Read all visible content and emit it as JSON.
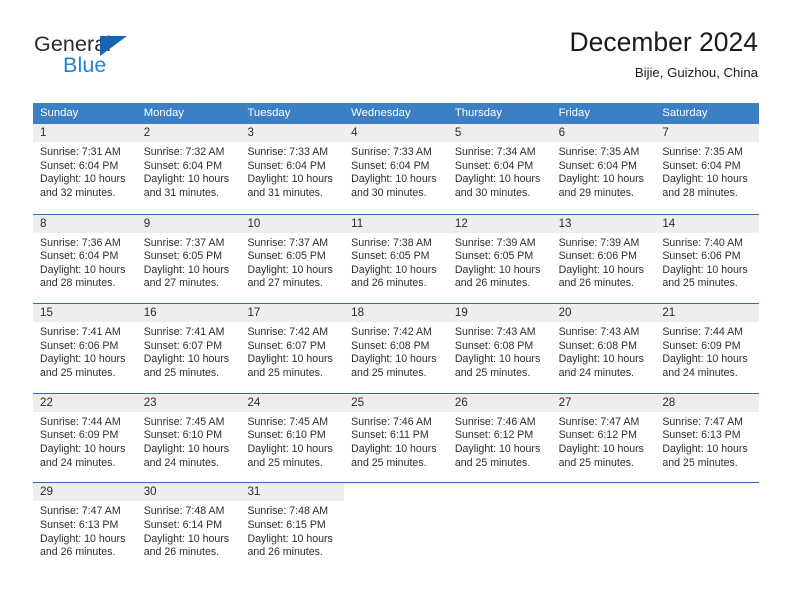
{
  "brand": {
    "word_one": "General",
    "word_two": "Blue",
    "triangle_icon": "triangle-icon"
  },
  "header": {
    "title": "December 2024",
    "location": "Bijie, Guizhou, China"
  },
  "colors": {
    "header_band": "#3b7fc4",
    "row_divider": "#2f6fb0",
    "daynum_band": "#eeeeee",
    "brand_dark": "#2b2b2b",
    "brand_blue": "#1f84d6",
    "logo_triangle": "#1665b0",
    "text": "#2e2e2e"
  },
  "weekday_headers": [
    "Sunday",
    "Monday",
    "Tuesday",
    "Wednesday",
    "Thursday",
    "Friday",
    "Saturday"
  ],
  "weeks": [
    [
      {
        "day": "1",
        "sunrise": "Sunrise: 7:31 AM",
        "sunset": "Sunset: 6:04 PM",
        "daylight_1": "Daylight: 10 hours",
        "daylight_2": "and 32 minutes."
      },
      {
        "day": "2",
        "sunrise": "Sunrise: 7:32 AM",
        "sunset": "Sunset: 6:04 PM",
        "daylight_1": "Daylight: 10 hours",
        "daylight_2": "and 31 minutes."
      },
      {
        "day": "3",
        "sunrise": "Sunrise: 7:33 AM",
        "sunset": "Sunset: 6:04 PM",
        "daylight_1": "Daylight: 10 hours",
        "daylight_2": "and 31 minutes."
      },
      {
        "day": "4",
        "sunrise": "Sunrise: 7:33 AM",
        "sunset": "Sunset: 6:04 PM",
        "daylight_1": "Daylight: 10 hours",
        "daylight_2": "and 30 minutes."
      },
      {
        "day": "5",
        "sunrise": "Sunrise: 7:34 AM",
        "sunset": "Sunset: 6:04 PM",
        "daylight_1": "Daylight: 10 hours",
        "daylight_2": "and 30 minutes."
      },
      {
        "day": "6",
        "sunrise": "Sunrise: 7:35 AM",
        "sunset": "Sunset: 6:04 PM",
        "daylight_1": "Daylight: 10 hours",
        "daylight_2": "and 29 minutes."
      },
      {
        "day": "7",
        "sunrise": "Sunrise: 7:35 AM",
        "sunset": "Sunset: 6:04 PM",
        "daylight_1": "Daylight: 10 hours",
        "daylight_2": "and 28 minutes."
      }
    ],
    [
      {
        "day": "8",
        "sunrise": "Sunrise: 7:36 AM",
        "sunset": "Sunset: 6:04 PM",
        "daylight_1": "Daylight: 10 hours",
        "daylight_2": "and 28 minutes."
      },
      {
        "day": "9",
        "sunrise": "Sunrise: 7:37 AM",
        "sunset": "Sunset: 6:05 PM",
        "daylight_1": "Daylight: 10 hours",
        "daylight_2": "and 27 minutes."
      },
      {
        "day": "10",
        "sunrise": "Sunrise: 7:37 AM",
        "sunset": "Sunset: 6:05 PM",
        "daylight_1": "Daylight: 10 hours",
        "daylight_2": "and 27 minutes."
      },
      {
        "day": "11",
        "sunrise": "Sunrise: 7:38 AM",
        "sunset": "Sunset: 6:05 PM",
        "daylight_1": "Daylight: 10 hours",
        "daylight_2": "and 26 minutes."
      },
      {
        "day": "12",
        "sunrise": "Sunrise: 7:39 AM",
        "sunset": "Sunset: 6:05 PM",
        "daylight_1": "Daylight: 10 hours",
        "daylight_2": "and 26 minutes."
      },
      {
        "day": "13",
        "sunrise": "Sunrise: 7:39 AM",
        "sunset": "Sunset: 6:06 PM",
        "daylight_1": "Daylight: 10 hours",
        "daylight_2": "and 26 minutes."
      },
      {
        "day": "14",
        "sunrise": "Sunrise: 7:40 AM",
        "sunset": "Sunset: 6:06 PM",
        "daylight_1": "Daylight: 10 hours",
        "daylight_2": "and 25 minutes."
      }
    ],
    [
      {
        "day": "15",
        "sunrise": "Sunrise: 7:41 AM",
        "sunset": "Sunset: 6:06 PM",
        "daylight_1": "Daylight: 10 hours",
        "daylight_2": "and 25 minutes."
      },
      {
        "day": "16",
        "sunrise": "Sunrise: 7:41 AM",
        "sunset": "Sunset: 6:07 PM",
        "daylight_1": "Daylight: 10 hours",
        "daylight_2": "and 25 minutes."
      },
      {
        "day": "17",
        "sunrise": "Sunrise: 7:42 AM",
        "sunset": "Sunset: 6:07 PM",
        "daylight_1": "Daylight: 10 hours",
        "daylight_2": "and 25 minutes."
      },
      {
        "day": "18",
        "sunrise": "Sunrise: 7:42 AM",
        "sunset": "Sunset: 6:08 PM",
        "daylight_1": "Daylight: 10 hours",
        "daylight_2": "and 25 minutes."
      },
      {
        "day": "19",
        "sunrise": "Sunrise: 7:43 AM",
        "sunset": "Sunset: 6:08 PM",
        "daylight_1": "Daylight: 10 hours",
        "daylight_2": "and 25 minutes."
      },
      {
        "day": "20",
        "sunrise": "Sunrise: 7:43 AM",
        "sunset": "Sunset: 6:08 PM",
        "daylight_1": "Daylight: 10 hours",
        "daylight_2": "and 24 minutes."
      },
      {
        "day": "21",
        "sunrise": "Sunrise: 7:44 AM",
        "sunset": "Sunset: 6:09 PM",
        "daylight_1": "Daylight: 10 hours",
        "daylight_2": "and 24 minutes."
      }
    ],
    [
      {
        "day": "22",
        "sunrise": "Sunrise: 7:44 AM",
        "sunset": "Sunset: 6:09 PM",
        "daylight_1": "Daylight: 10 hours",
        "daylight_2": "and 24 minutes."
      },
      {
        "day": "23",
        "sunrise": "Sunrise: 7:45 AM",
        "sunset": "Sunset: 6:10 PM",
        "daylight_1": "Daylight: 10 hours",
        "daylight_2": "and 24 minutes."
      },
      {
        "day": "24",
        "sunrise": "Sunrise: 7:45 AM",
        "sunset": "Sunset: 6:10 PM",
        "daylight_1": "Daylight: 10 hours",
        "daylight_2": "and 25 minutes."
      },
      {
        "day": "25",
        "sunrise": "Sunrise: 7:46 AM",
        "sunset": "Sunset: 6:11 PM",
        "daylight_1": "Daylight: 10 hours",
        "daylight_2": "and 25 minutes."
      },
      {
        "day": "26",
        "sunrise": "Sunrise: 7:46 AM",
        "sunset": "Sunset: 6:12 PM",
        "daylight_1": "Daylight: 10 hours",
        "daylight_2": "and 25 minutes."
      },
      {
        "day": "27",
        "sunrise": "Sunrise: 7:47 AM",
        "sunset": "Sunset: 6:12 PM",
        "daylight_1": "Daylight: 10 hours",
        "daylight_2": "and 25 minutes."
      },
      {
        "day": "28",
        "sunrise": "Sunrise: 7:47 AM",
        "sunset": "Sunset: 6:13 PM",
        "daylight_1": "Daylight: 10 hours",
        "daylight_2": "and 25 minutes."
      }
    ],
    [
      {
        "day": "29",
        "sunrise": "Sunrise: 7:47 AM",
        "sunset": "Sunset: 6:13 PM",
        "daylight_1": "Daylight: 10 hours",
        "daylight_2": "and 26 minutes."
      },
      {
        "day": "30",
        "sunrise": "Sunrise: 7:48 AM",
        "sunset": "Sunset: 6:14 PM",
        "daylight_1": "Daylight: 10 hours",
        "daylight_2": "and 26 minutes."
      },
      {
        "day": "31",
        "sunrise": "Sunrise: 7:48 AM",
        "sunset": "Sunset: 6:15 PM",
        "daylight_1": "Daylight: 10 hours",
        "daylight_2": "and 26 minutes."
      },
      {
        "day": "",
        "sunrise": "",
        "sunset": "",
        "daylight_1": "",
        "daylight_2": ""
      },
      {
        "day": "",
        "sunrise": "",
        "sunset": "",
        "daylight_1": "",
        "daylight_2": ""
      },
      {
        "day": "",
        "sunrise": "",
        "sunset": "",
        "daylight_1": "",
        "daylight_2": ""
      },
      {
        "day": "",
        "sunrise": "",
        "sunset": "",
        "daylight_1": "",
        "daylight_2": ""
      }
    ]
  ]
}
